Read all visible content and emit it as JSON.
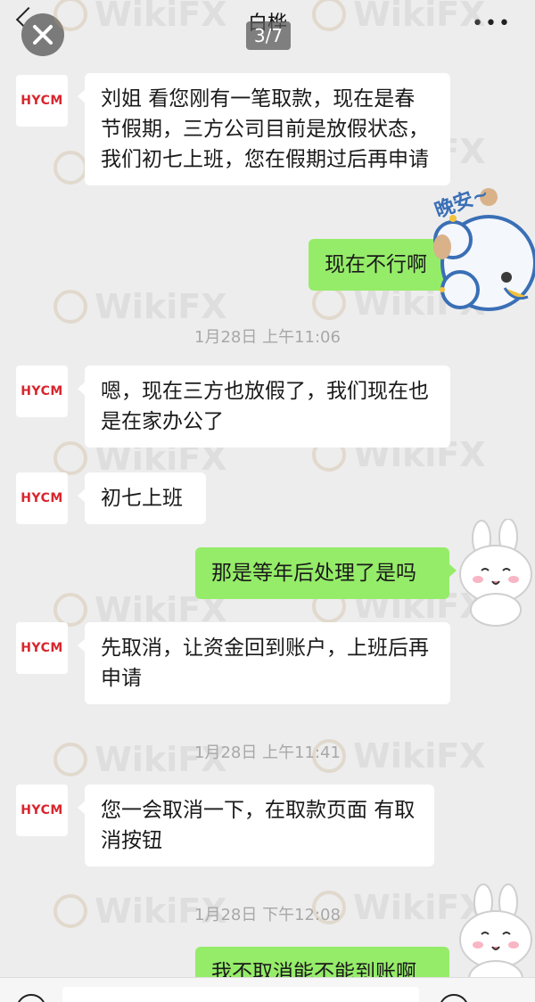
{
  "header": {
    "title": "白桦",
    "page_counter": "3/7",
    "more_label": "•••"
  },
  "watermark_text": "WikiFX",
  "avatar_text": "HYCM",
  "messages": [
    {
      "side": "left",
      "text": "刘姐 看您刚有一笔取款，现在是春节假期，三方公司目前是放假状态，我们初七上班，您在假期过后再申请"
    },
    {
      "side": "right",
      "text": "现在不行啊"
    },
    {
      "side": "left",
      "text": "嗯，现在三方也放假了，我们现在也是在家办公了"
    },
    {
      "side": "left",
      "text": "初七上班"
    },
    {
      "side": "right",
      "text": "那是等年后处理了是吗"
    },
    {
      "side": "left",
      "text": "先取消，让资金回到账户，上班后再申请"
    },
    {
      "side": "left",
      "text": "您一会取消一下，在取款页面 有取消按钮"
    },
    {
      "side": "right",
      "text": "我不取消能不能到账啊"
    }
  ],
  "timestamps": [
    "1月28日 上午11:06",
    "1月28日 上午11:41",
    "1月28日 下午12:08"
  ],
  "stickers": {
    "sticker1_text": "晚安~"
  },
  "colors": {
    "background": "#ededed",
    "bubble_self": "#95ec69",
    "bubble_other": "#ffffff",
    "brand_red": "#d8262e"
  }
}
